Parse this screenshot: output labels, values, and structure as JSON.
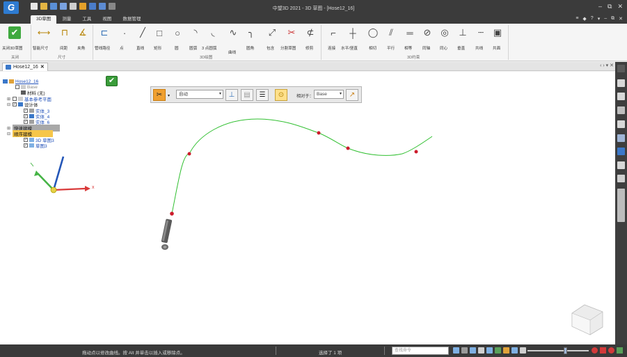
{
  "app": {
    "logo_text": "G",
    "window_title": "中望3D 2021 - 3D 草图 - [Hose12_16]"
  },
  "window_controls": [
    "‒",
    "⧉",
    "✕"
  ],
  "tabs": [
    {
      "label": "3D草图",
      "active": true
    },
    {
      "label": "测量",
      "active": false
    },
    {
      "label": "工具",
      "active": false
    },
    {
      "label": "视图",
      "active": false
    },
    {
      "label": "数据管理",
      "active": false
    }
  ],
  "tab_right": [
    "≡",
    "◆",
    "?",
    "▾",
    "‒",
    "⧉",
    "✕"
  ],
  "ribbon": {
    "buttons": [
      {
        "label": "关闭3D草图",
        "icon": "exit-sketch-icon"
      },
      {
        "label": "智能尺寸",
        "icon": "smart-dimension-icon"
      },
      {
        "label": "间距",
        "icon": "distance-icon"
      },
      {
        "label": "夹角",
        "icon": "angle-icon"
      },
      {
        "label": "管线路径",
        "icon": "pipe-path-icon"
      },
      {
        "label": "点",
        "icon": "point-icon"
      },
      {
        "label": "直线",
        "icon": "line-icon"
      },
      {
        "label": "矩形",
        "icon": "rectangle-icon"
      },
      {
        "label": "圆",
        "icon": "circle-icon"
      },
      {
        "label": "圆弧",
        "icon": "arc-icon"
      },
      {
        "label": "3 点圆弧",
        "icon": "three-point-arc-icon"
      },
      {
        "label": "曲线",
        "icon": "curve-icon"
      },
      {
        "label": "圆角",
        "icon": "fillet-icon"
      },
      {
        "label": "包含",
        "icon": "include-icon"
      },
      {
        "label": "分割草图",
        "icon": "split-sketch-icon"
      },
      {
        "label": "修剪",
        "icon": "trim-icon"
      },
      {
        "label": "连接",
        "icon": "connect-icon"
      },
      {
        "label": "水平/竖直",
        "icon": "horizontal-vertical-icon"
      },
      {
        "label": "相切",
        "icon": "tangent-icon"
      },
      {
        "label": "平行",
        "icon": "parallel-icon"
      },
      {
        "label": "相等",
        "icon": "equal-icon"
      },
      {
        "label": "同轴",
        "icon": "coaxial-icon"
      },
      {
        "label": "同心",
        "icon": "concentric-icon"
      },
      {
        "label": "垂直",
        "icon": "perpendicular-icon"
      },
      {
        "label": "共线",
        "icon": "collinear-icon"
      },
      {
        "label": "共面",
        "icon": "coplanar-icon"
      }
    ],
    "groups": [
      "关闭",
      "尺寸",
      "3D绘图",
      "3D约束"
    ]
  },
  "doc_tab": {
    "label": "Hose12_16",
    "close": "✕"
  },
  "doc_nav": "‹ › ▾ ✕",
  "tree": {
    "rows": [
      {
        "label": "Hose12_16",
        "indent": 0,
        "expander": "",
        "checkbox": "",
        "style": "link"
      },
      {
        "label": "Base",
        "indent": 1,
        "expander": "",
        "checkbox": "☐",
        "style": "gray"
      },
      {
        "label": "材料 (无)",
        "indent": 1,
        "expander": "",
        "checkbox": "",
        "style": "normal"
      },
      {
        "label": "基本参考平面",
        "indent": 0,
        "expander": "⊞",
        "checkbox": "☐",
        "style": "normal"
      },
      {
        "label": "设计体",
        "indent": 0,
        "expander": "⊟",
        "checkbox": "☑",
        "style": "normal"
      },
      {
        "label": "实体_3",
        "indent": 2,
        "expander": "",
        "checkbox": "☑",
        "style": "normal"
      },
      {
        "label": "实体_4",
        "indent": 2,
        "expander": "",
        "checkbox": "☑",
        "style": "normal"
      },
      {
        "label": "实体_6",
        "indent": 2,
        "expander": "",
        "checkbox": "☑",
        "style": "normal"
      },
      {
        "label": "快速建模",
        "indent": 0,
        "expander": "⊞",
        "checkbox": "",
        "style": "highlight-gray"
      },
      {
        "label": "顺序建模",
        "indent": 0,
        "expander": "⊟",
        "checkbox": "",
        "style": "highlight-yellow"
      },
      {
        "label": "3D 草图3",
        "indent": 2,
        "expander": "",
        "checkbox": "☑",
        "style": "normal"
      },
      {
        "label": "草图3",
        "indent": 2,
        "expander": "",
        "checkbox": "☑",
        "style": "normal"
      }
    ]
  },
  "float_toolbar": {
    "mode_value": "自动",
    "relative_label": "相对于：",
    "relative_value": "Base"
  },
  "triad": {
    "x_label": "x"
  },
  "status": {
    "hint": "拖动点以修改曲线。按 Alt 并单击以插入或移除点。",
    "selection": "选择了 1 项",
    "command_placeholder": "查找命令"
  },
  "colors": {
    "spline": "#2fbf2f",
    "control_point": "#cc1b2b",
    "accent": "#2e7bd1",
    "tree_highlight": "#f6c64a"
  }
}
